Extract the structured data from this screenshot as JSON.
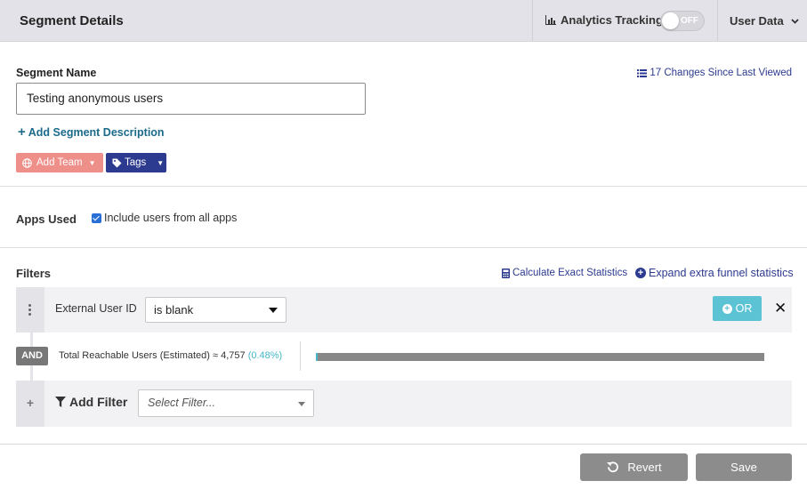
{
  "header": {
    "title": "Segment Details",
    "analytics_label": "Analytics Tracking",
    "toggle_state": "OFF",
    "user_data_label": "User Data"
  },
  "segment": {
    "name_label": "Segment Name",
    "name_value": "Testing anonymous users",
    "changes_link": "17 Changes Since Last Viewed",
    "add_description": "Add Segment Description",
    "add_team": "Add Team",
    "tags": "Tags"
  },
  "apps": {
    "label": "Apps Used",
    "include_all": "Include users from all apps",
    "include_all_checked": true
  },
  "filters": {
    "label": "Filters",
    "calculate_link": "Calculate Exact Statistics",
    "expand_link": "Expand extra funnel statistics",
    "rows": [
      {
        "field": "External User ID",
        "operator": "is blank"
      }
    ],
    "or_label": "OR",
    "close_symbol": "✕",
    "and_label": "AND",
    "reach_label": "Total Reachable Users (Estimated) ≈ ",
    "reach_value": "4,757",
    "reach_pct": "(0.48%)",
    "reach_fraction": 0.0048,
    "add_filter_label": "Add Filter",
    "select_filter_placeholder": "Select Filter..."
  },
  "footer": {
    "revert": "Revert",
    "save": "Save"
  },
  "colors": {
    "header_bg": "#e2e2e8",
    "brand_navy": "#2c3a8f",
    "team_coral": "#ee8f8a",
    "accent_teal": "#47b6c9",
    "or_teal": "#5bc3d4",
    "disabled_gray": "#8c8c8c"
  }
}
